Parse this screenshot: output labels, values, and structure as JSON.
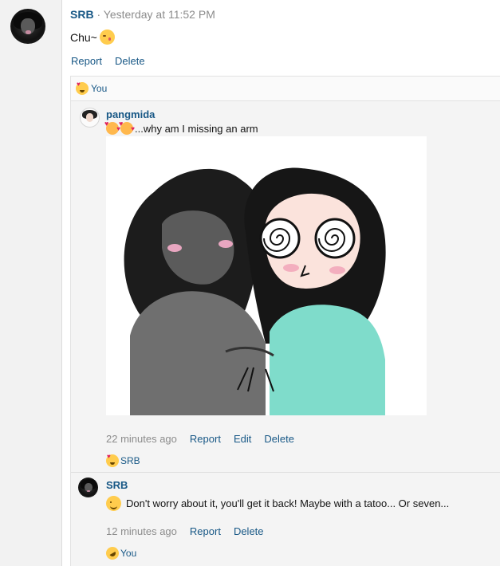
{
  "post": {
    "author": "SRB",
    "separator": "·",
    "time": "Yesterday at 11:52 PM",
    "text": "Chu~",
    "emoji": "kissing-face-emoji",
    "actions": {
      "report": "Report",
      "delete": "Delete"
    }
  },
  "post_reactions": {
    "emoji": "heart-eyes-emoji",
    "who": "You"
  },
  "comments": [
    {
      "author": "pangmida",
      "emojis": [
        "smiling-hearts-emoji",
        "smiling-hearts-emoji"
      ],
      "text": "...why am I missing an arm",
      "time": "22 minutes ago",
      "actions": {
        "report": "Report",
        "edit": "Edit",
        "delete": "Delete"
      },
      "reactions": {
        "emoji": "heart-eyes-emoji",
        "who": "SRB"
      }
    },
    {
      "author": "SRB",
      "emoji": "winking-face-emoji",
      "text": "Don't worry about it, you'll get it back! Maybe with a tatoo... Or seven...",
      "time": "12 minutes ago",
      "actions": {
        "report": "Report",
        "delete": "Delete"
      },
      "reactions": {
        "emoji": "rolling-laughing-emoji",
        "who": "You"
      }
    }
  ],
  "colors": {
    "link": "#185886",
    "meta": "#8c8c8c",
    "gutter": "#f2f2f2",
    "comment_bg": "#f4f4f4"
  }
}
